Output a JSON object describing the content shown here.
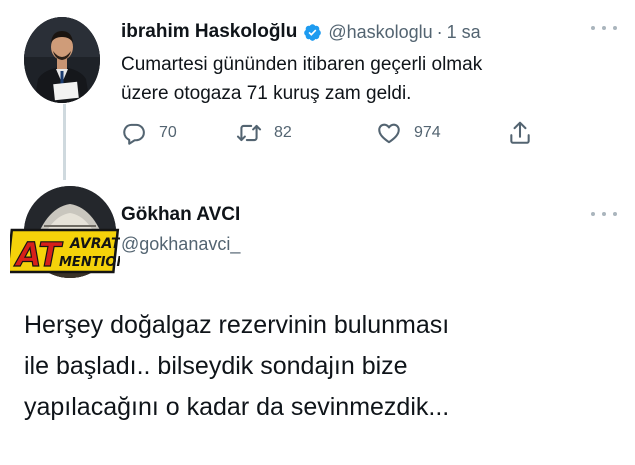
{
  "tweet_1": {
    "author_name": "ibrahim Haskoloğlu",
    "verified": true,
    "handle": "@haskologlu",
    "separator": "·",
    "time": "1 sa",
    "text_line1": "Cumartesi gününden itibaren geçerli olmak",
    "text_line2": "üzere otogaza 71 kuruş zam geldi.",
    "actions": {
      "reply_icon": "reply-icon",
      "reply_count": "70",
      "retweet_icon": "retweet-icon",
      "retweet_count": "82",
      "like_icon": "heart-icon",
      "like_count": "974",
      "share_icon": "share-icon"
    }
  },
  "tweet_2": {
    "author_name": "Gökhan AVCI",
    "handle": "@gokhanavci_",
    "avatar_badge_line1": "AT",
    "avatar_badge_line2": "AVRAT",
    "avatar_badge_line3": "MENTION",
    "text_line1": "Herşey doğalgaz rezervinin bulunması",
    "text_line2": "ile başladı.. bilseydik sondajın bize",
    "text_line3": "yapılacağını o kadar da sevinmezdik..."
  },
  "colors": {
    "text_primary": "#0f1419",
    "text_secondary": "#536471",
    "verified_blue": "#1d9bf0",
    "thread_line": "#cfd9de",
    "badge_yellow": "#f5d20a",
    "badge_red": "#d8201a"
  }
}
